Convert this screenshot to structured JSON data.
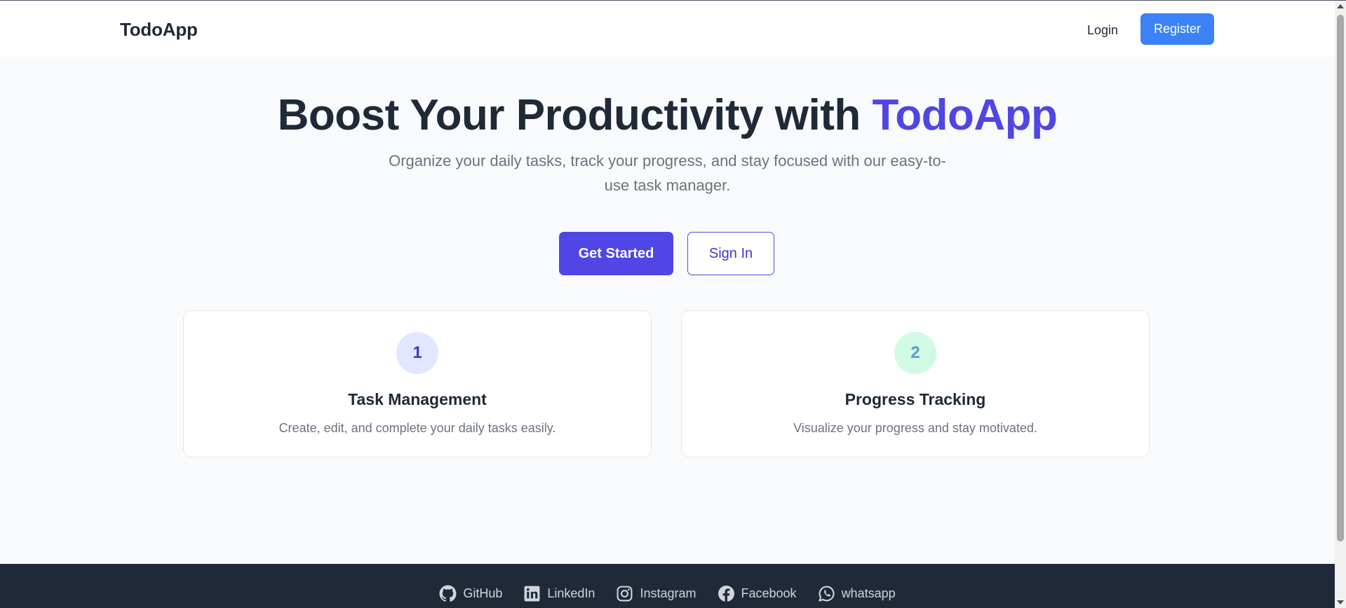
{
  "navbar": {
    "brand": "TodoApp",
    "login_label": "Login",
    "register_label": "Register"
  },
  "hero": {
    "title_main": "Boost Your Productivity with ",
    "title_accent": "TodoApp",
    "subtitle": "Organize your daily tasks, track your progress, and stay focused with our easy-to-use task manager.",
    "primary_button": "Get Started",
    "secondary_button": "Sign In"
  },
  "features": [
    {
      "number": "1",
      "title": "Task Management",
      "description": "Create, edit, and complete your daily tasks easily."
    },
    {
      "number": "2",
      "title": "Progress Tracking",
      "description": "Visualize your progress and stay motivated."
    }
  ],
  "footer": {
    "links": [
      {
        "label": "GitHub",
        "icon": "github-icon"
      },
      {
        "label": "LinkedIn",
        "icon": "linkedin-icon"
      },
      {
        "label": "Instagram",
        "icon": "instagram-icon"
      },
      {
        "label": "Facebook",
        "icon": "facebook-icon"
      },
      {
        "label": "whatsapp",
        "icon": "whatsapp-icon"
      }
    ]
  },
  "colors": {
    "accent": "#4f46e5",
    "register_button": "#3b82f6",
    "footer_background": "#1f2937",
    "page_background": "#f9fafb"
  }
}
